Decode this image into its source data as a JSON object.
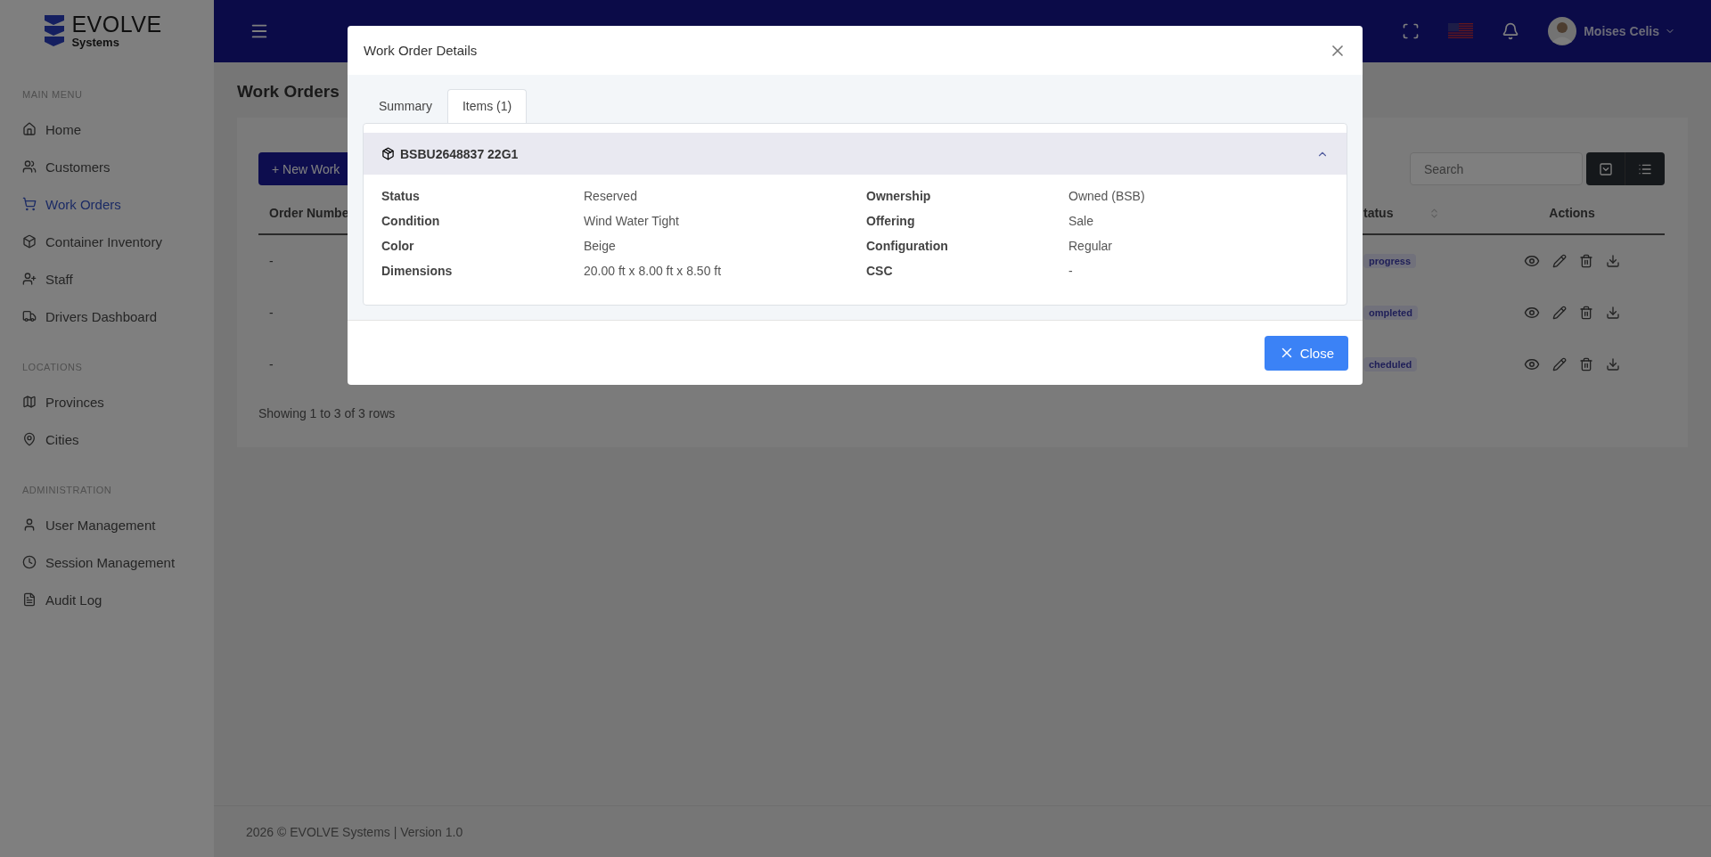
{
  "sidebar": {
    "logo": {
      "name": "EVOLVE",
      "sub": "Systems"
    },
    "sections": [
      {
        "label": "MAIN MENU",
        "items": [
          {
            "label": "Home",
            "selected": false
          },
          {
            "label": "Customers",
            "selected": false
          },
          {
            "label": "Work Orders",
            "selected": true
          },
          {
            "label": "Container Inventory",
            "selected": false
          },
          {
            "label": "Staff",
            "selected": false
          },
          {
            "label": "Drivers Dashboard",
            "selected": false
          }
        ]
      },
      {
        "label": "LOCATIONS",
        "items": [
          {
            "label": "Provinces",
            "selected": false
          },
          {
            "label": "Cities",
            "selected": false
          }
        ]
      },
      {
        "label": "ADMINISTRATION",
        "items": [
          {
            "label": "User Management",
            "selected": false
          },
          {
            "label": "Session Management",
            "selected": false
          },
          {
            "label": "Audit Log",
            "selected": false
          }
        ]
      }
    ]
  },
  "header": {
    "user_name": "Moises Celis"
  },
  "page": {
    "title": "Work Orders",
    "new_button": "+ New Work",
    "search": {
      "placeholder": "Search"
    },
    "table": {
      "columns": [
        "Order Numbe",
        "tatus",
        "Actions"
      ],
      "rows": [
        {
          "order": "-",
          "status": "progress"
        },
        {
          "order": "-",
          "status": "ompleted"
        },
        {
          "order": "-",
          "status": "cheduled"
        }
      ],
      "summary": "Showing 1 to 3 of 3 rows"
    }
  },
  "footer": "2026 © EVOLVE Systems | Version 1.0",
  "modal": {
    "title": "Work Order Details",
    "tabs": [
      {
        "label": "Summary",
        "selected": false
      },
      {
        "label": "Items (1)",
        "selected": true
      }
    ],
    "item": {
      "title": "BSBU2648837 22G1",
      "expanded": true,
      "fields": [
        {
          "label": "Status",
          "value": "Reserved"
        },
        {
          "label": "Ownership",
          "value": "Owned (BSB)"
        },
        {
          "label": "Condition",
          "value": "Wind Water Tight"
        },
        {
          "label": "Offering",
          "value": "Sale"
        },
        {
          "label": "Color",
          "value": "Beige"
        },
        {
          "label": "Configuration",
          "value": "Regular"
        },
        {
          "label": "Dimensions",
          "value": "20.00 ft x 8.00 ft x 8.50 ft"
        },
        {
          "label": "CSC",
          "value": "-"
        }
      ]
    },
    "close_button": "Close"
  }
}
